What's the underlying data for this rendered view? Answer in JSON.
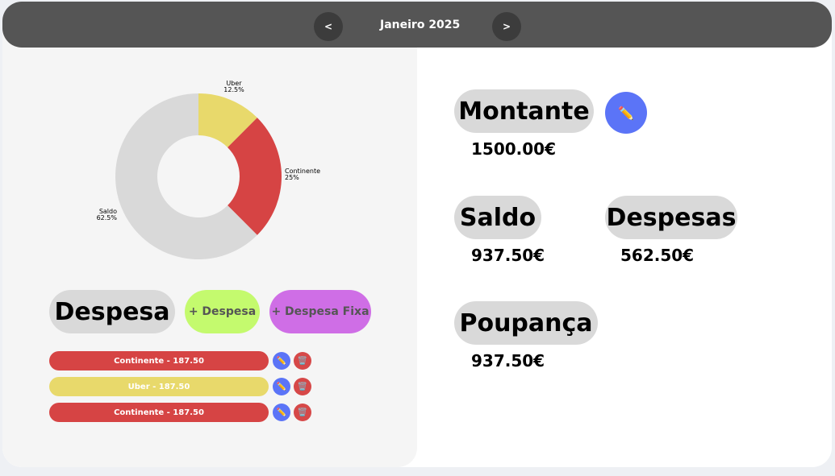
{
  "header": {
    "prev_label": "<",
    "month": "Janeiro 2025",
    "next_label": ">"
  },
  "chart_data": {
    "type": "pie",
    "categories": [
      "Uber",
      "Continente",
      "Saldo"
    ],
    "values": [
      12.5,
      25,
      62.5
    ],
    "colors": [
      "#e8d96b",
      "#d64444",
      "#d9d9d9"
    ],
    "percent_labels": [
      "12.5%",
      "25%",
      "62.5%"
    ],
    "donut": true
  },
  "expenses": {
    "title": "Despesa",
    "add_label": "+ Despesa",
    "add_fixed_label": "+ Despesa Fixa",
    "items": [
      {
        "label": "Continente - 187.50",
        "color": "#d64444"
      },
      {
        "label": "Uber - 187.50",
        "color": "#e8d96b"
      },
      {
        "label": "Continente - 187.50",
        "color": "#d64444"
      }
    ],
    "edit_icon": "pencil-icon",
    "delete_icon": "trash-icon"
  },
  "summary": {
    "montante_title": "Montante",
    "montante_value": "1500.00€",
    "saldo_title": "Saldo",
    "saldo_value": "937.50€",
    "despesas_title": "Despesas",
    "despesas_value": "562.50€",
    "poupanca_title": "Poupança",
    "poupanca_value": "937.50€"
  },
  "colors": {
    "accent_blue": "#5b74f7",
    "green": "#c4fa6e",
    "purple": "#cf6ee6",
    "header": "#555555"
  }
}
